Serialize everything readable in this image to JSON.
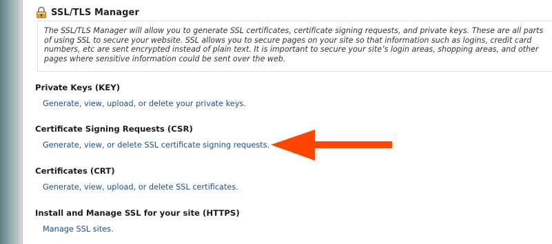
{
  "header": {
    "title": "SSL/TLS Manager",
    "icon": "ssl-lock-icon"
  },
  "intro": {
    "text": "The SSL/TLS Manager will allow you to generate SSL certificates, certificate signing requests, and private keys. These are all parts of using SSL to secure your website. SSL allows you to secure pages on your site so that information such as logins, credit card numbers, etc are sent encrypted instead of plain text. It is important to secure your site’s login areas, shopping areas, and other pages where sensitive information could be sent over the web."
  },
  "sections": [
    {
      "heading": "Private Keys (KEY)",
      "link": "Generate, view, upload, or delete your private keys."
    },
    {
      "heading": "Certificate Signing Requests (CSR)",
      "link": "Generate, view, or delete SSL certificate signing requests."
    },
    {
      "heading": "Certificates (CRT)",
      "link": "Generate, view, upload, or delete SSL certificates."
    },
    {
      "heading": "Install and Manage SSL for your site (HTTPS)",
      "link": "Manage SSL sites."
    }
  ],
  "colors": {
    "link": "#1c4e8e",
    "arrow": "#ff4500",
    "sidebar": "#5e7d83"
  },
  "annotation": {
    "icon": "red-arrow-icon"
  }
}
